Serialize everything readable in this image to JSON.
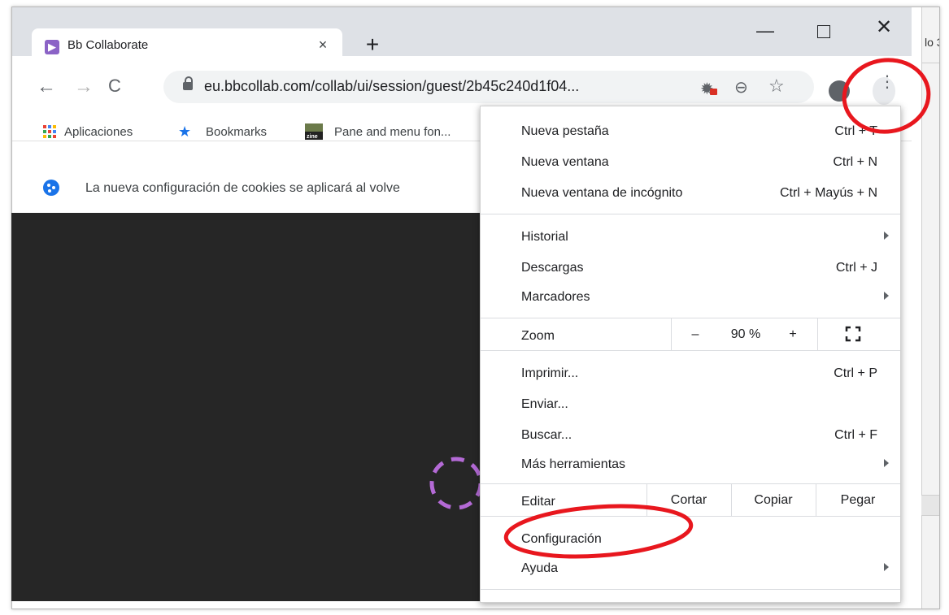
{
  "window": {
    "tab_title": "Bb Collaborate",
    "tab_close": "×",
    "new_tab": "+",
    "minimize": "—",
    "close": "✕",
    "background_fragment": "lo 3"
  },
  "toolbar": {
    "back": "←",
    "forward": "→",
    "reload": "C",
    "url": "eu.bbcollab.com/collab/ui/session/guest/2b45c240d1f04...",
    "menu_dots": "⋮"
  },
  "bookmarks": {
    "apps": "Aplicaciones",
    "bookmarks": "Bookmarks",
    "zine_badge": "zine",
    "pane": "Pane and menu fon..."
  },
  "infobar": {
    "text": "La nueva configuración de cookies se aplicará al volve"
  },
  "menu": {
    "new_tab": {
      "label": "Nueva pestaña",
      "shortcut": "Ctrl + T"
    },
    "new_window": {
      "label": "Nueva ventana",
      "shortcut": "Ctrl + N"
    },
    "incognito": {
      "label": "Nueva ventana de incógnito",
      "shortcut": "Ctrl + Mayús + N"
    },
    "history": {
      "label": "Historial"
    },
    "downloads": {
      "label": "Descargas",
      "shortcut": "Ctrl + J"
    },
    "bookmarks": {
      "label": "Marcadores"
    },
    "zoom": {
      "label": "Zoom",
      "minus": "–",
      "value": "90 %",
      "plus": "+"
    },
    "print": {
      "label": "Imprimir...",
      "shortcut": "Ctrl + P"
    },
    "cast": {
      "label": "Enviar..."
    },
    "find": {
      "label": "Buscar...",
      "shortcut": "Ctrl + F"
    },
    "more_tools": {
      "label": "Más herramientas"
    },
    "edit": {
      "label": "Editar",
      "cut": "Cortar",
      "copy": "Copiar",
      "paste": "Pegar"
    },
    "settings": {
      "label": "Configuración"
    },
    "help": {
      "label": "Ayuda"
    }
  },
  "colors": {
    "annotation_red": "#e8171e",
    "loading_ring": "#b46ad6",
    "page_bg": "#262626"
  }
}
